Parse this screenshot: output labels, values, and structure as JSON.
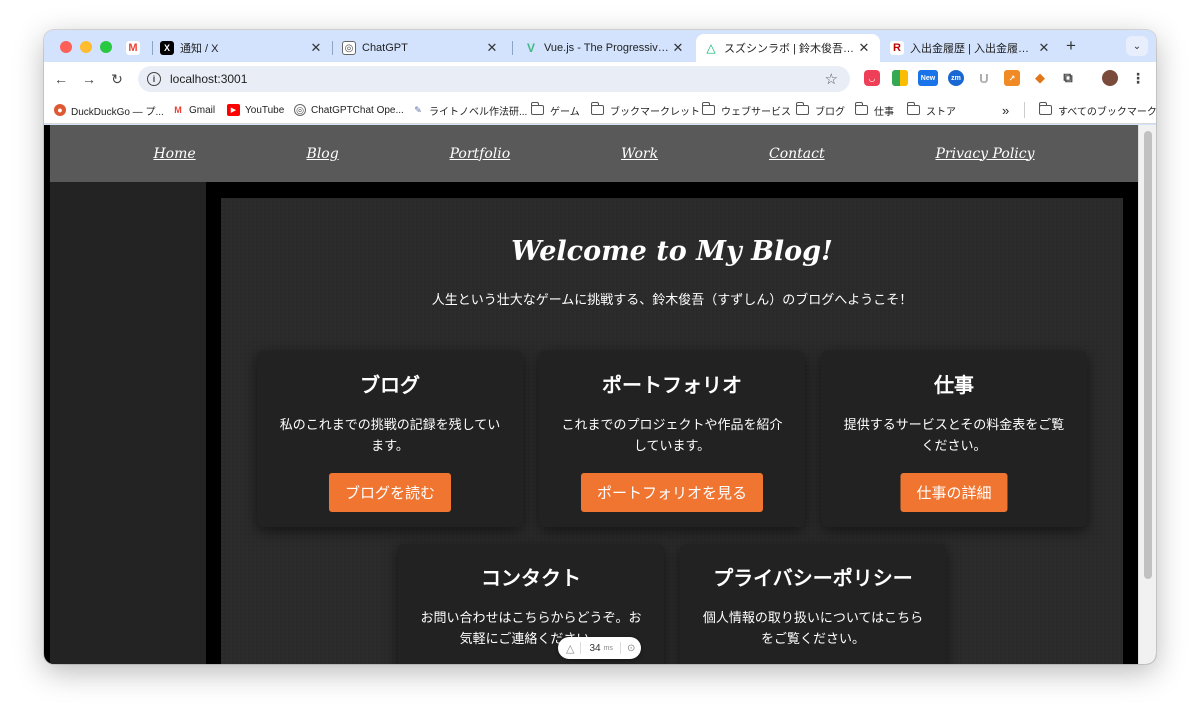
{
  "tabs": [
    {
      "title": "",
      "icon": "gmail-icon",
      "color": "#ea4335",
      "glyph": "M"
    },
    {
      "title": "通知 / X",
      "icon": "x-icon",
      "color": "#000000",
      "glyph": "𝕏"
    },
    {
      "title": "ChatGPT",
      "icon": "chatgpt-icon",
      "color": "#6b6b6b",
      "glyph": "◎"
    },
    {
      "title": "Vue.js - The Progressive JavaScript",
      "icon": "vue-icon",
      "color": "#42b883",
      "glyph": "V"
    },
    {
      "title": "スズシンラボ | 鈴木俊吾（すずしん）",
      "icon": "nuxt-icon",
      "color": "#00dc82",
      "glyph": "△"
    },
    {
      "title": "入出金履歴 | 入出金履歴 | 入出金",
      "icon": "rakuten-icon",
      "color": "#bf0000",
      "glyph": "R"
    }
  ],
  "toolbar": {
    "url": "localhost:3001",
    "back": "←",
    "forward": "→",
    "reload": "↻"
  },
  "bookmarks": [
    {
      "label": "DuckDuckGo — プ...",
      "icon": "duckduckgo-icon"
    },
    {
      "label": "Gmail",
      "icon": "gmail-icon"
    },
    {
      "label": "YouTube",
      "icon": "youtube-icon"
    },
    {
      "label": "ChatGPTChat Ope...",
      "icon": "chatgpt-icon"
    },
    {
      "label": "ライトノベル作法研...",
      "icon": "note-icon"
    },
    {
      "label": "ゲーム",
      "icon": "folder-icon"
    },
    {
      "label": "ブックマークレット",
      "icon": "folder-icon"
    },
    {
      "label": "ウェブサービス",
      "icon": "folder-icon"
    },
    {
      "label": "ブログ",
      "icon": "folder-icon"
    },
    {
      "label": "仕事",
      "icon": "folder-icon"
    },
    {
      "label": "ストア",
      "icon": "folder-icon"
    },
    {
      "label": "»",
      "icon": "overflow-chevron-icon"
    },
    {
      "label": "すべてのブックマーク",
      "icon": "folder-icon"
    }
  ],
  "site": {
    "nav": [
      "Home",
      "Blog",
      "Portfolio",
      "Work",
      "Contact",
      "Privacy Policy"
    ],
    "title": "Welcome to My Blog!",
    "subtitle": "人生という壮大なゲームに挑戦する、鈴木俊吾（すずしん）のブログへようこそ！",
    "cards": [
      {
        "title": "ブログ",
        "desc": "私のこれまでの挑戦の記録を残しています。",
        "button": "ブログを読む"
      },
      {
        "title": "ポートフォリオ",
        "desc": "これまでのプロジェクトや作品を紹介しています。",
        "button": "ポートフォリオを見る"
      },
      {
        "title": "仕事",
        "desc": "提供するサービスとその料金表をご覧ください。",
        "button": "仕事の詳細"
      },
      {
        "title": "コンタクト",
        "desc": "お問い合わせはこちらからどうぞ。お気軽にご連絡ください。",
        "button": ""
      },
      {
        "title": "プライバシーポリシー",
        "desc": "個人情報の取り扱いについてはこちらをご覧ください。",
        "button": ""
      }
    ],
    "accent": "#f07530"
  },
  "devtools_badge": {
    "value": "34",
    "unit": "ms"
  }
}
